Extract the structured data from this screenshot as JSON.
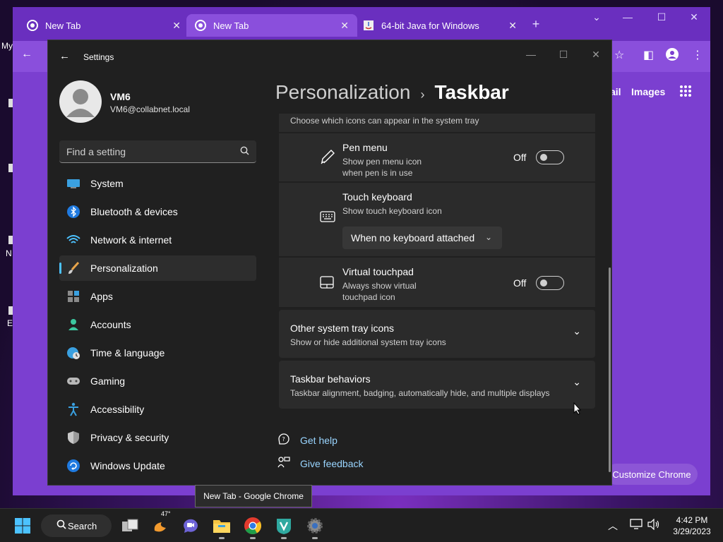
{
  "desktop": {
    "text_my": "My",
    "text_n": "N",
    "text_e": "E"
  },
  "chrome": {
    "tabs": [
      {
        "title": "New Tab",
        "favicon": "chrome-icon"
      },
      {
        "title": "New Tab",
        "favicon": "chrome-icon"
      },
      {
        "title": "64-bit Java for Windows",
        "favicon": "java-icon"
      }
    ],
    "ntp_links": {
      "gmail_partial": "ail",
      "images": "Images"
    },
    "customize_label": "Customize Chrome"
  },
  "settings": {
    "title": "Settings",
    "profile": {
      "name": "VM6",
      "email": "VM6@collabnet.local"
    },
    "search_placeholder": "Find a setting",
    "nav": [
      {
        "label": "System",
        "icon": "monitor-icon"
      },
      {
        "label": "Bluetooth & devices",
        "icon": "bluetooth-icon"
      },
      {
        "label": "Network & internet",
        "icon": "wifi-icon"
      },
      {
        "label": "Personalization",
        "icon": "paintbrush-icon",
        "selected": true
      },
      {
        "label": "Apps",
        "icon": "apps-icon"
      },
      {
        "label": "Accounts",
        "icon": "person-icon"
      },
      {
        "label": "Time & language",
        "icon": "globe-clock-icon"
      },
      {
        "label": "Gaming",
        "icon": "gamepad-icon"
      },
      {
        "label": "Accessibility",
        "icon": "accessibility-icon"
      },
      {
        "label": "Privacy & security",
        "icon": "shield-icon"
      },
      {
        "label": "Windows Update",
        "icon": "refresh-icon"
      }
    ],
    "breadcrumb": {
      "parent": "Personalization",
      "separator": "›",
      "current": "Taskbar"
    },
    "content": {
      "tray_header_desc": "Choose which icons can appear in the system tray",
      "pen_menu": {
        "title": "Pen menu",
        "desc_line1": "Show pen menu icon",
        "desc_line2": "when pen is in use",
        "state": "Off"
      },
      "touch_keyboard": {
        "title": "Touch keyboard",
        "desc": "Show touch keyboard icon",
        "dropdown_value": "When no keyboard attached"
      },
      "virtual_touchpad": {
        "title": "Virtual touchpad",
        "desc_line1": "Always show virtual",
        "desc_line2": "touchpad icon",
        "state": "Off"
      },
      "other_tray": {
        "title": "Other system tray icons",
        "desc": "Show or hide additional system tray icons"
      },
      "taskbar_behaviors": {
        "title": "Taskbar behaviors",
        "desc": "Taskbar alignment, badging, automatically hide, and multiple displays"
      }
    },
    "help": {
      "get_help": "Get help",
      "give_feedback": "Give feedback"
    }
  },
  "tooltip": "New Tab - Google Chrome",
  "taskbar": {
    "search_label": "Search",
    "weather_temp": "47°",
    "time": "4:42 PM",
    "date": "3/29/2023"
  },
  "colors": {
    "accent": "#4cc2ff",
    "link": "#99d5ff",
    "chrome_purple": "#7b3fd0",
    "settings_bg": "#202020",
    "card_bg": "#2b2b2b"
  }
}
